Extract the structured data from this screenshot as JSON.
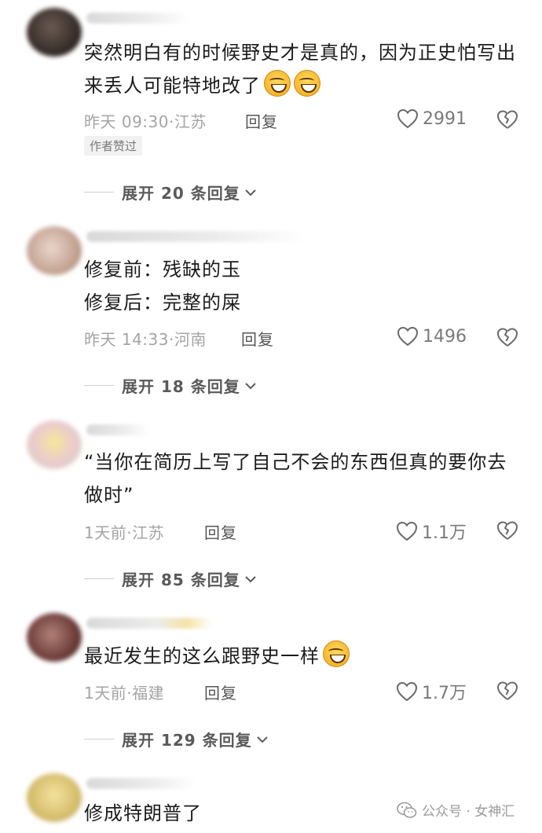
{
  "comments": [
    {
      "text": "突然明白有的时候野史才是真的，因为正史怕写出来丢人可能特地改了",
      "emoji_count": 2,
      "time": "昨天 09:30",
      "location": "江苏",
      "reply_label": "回复",
      "likes": "2991",
      "badge": "作者赞过",
      "expand_label": "展开 20 条回复"
    },
    {
      "line1": "修复前：残缺的玉",
      "line2": "修复后：完整的屎",
      "time": "昨天 14:33",
      "location": "河南",
      "reply_label": "回复",
      "likes": "1496",
      "expand_label": "展开 18 条回复"
    },
    {
      "text": "“当你在简历上写了自己不会的东西但真的要你去做时”",
      "time": "1天前",
      "location": "江苏",
      "reply_label": "回复",
      "likes": "1.1万",
      "expand_label": "展开 85 条回复"
    },
    {
      "text": "最近发生的这么跟野史一样",
      "emoji_count": 1,
      "time": "1天前",
      "location": "福建",
      "reply_label": "回复",
      "likes": "1.7万",
      "expand_label": "展开 129 条回复"
    },
    {
      "text": "修成特朗普了"
    }
  ],
  "meta_separator": "·",
  "watermark": {
    "text": "公众号 · 女神汇"
  },
  "icons": {
    "like": "heart-outline-icon",
    "dislike": "broken-heart-icon",
    "expand": "chevron-down-icon",
    "emoji": "grinning-face-emoji-icon",
    "watermark": "wechat-icon"
  }
}
